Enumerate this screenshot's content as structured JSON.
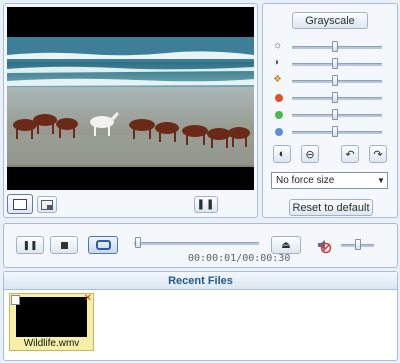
{
  "effects": {
    "grayscale_label": "Grayscale",
    "sliders": [
      {
        "icon": "brightness-icon",
        "level": 0.48
      },
      {
        "icon": "contrast-icon",
        "level": 0.48
      },
      {
        "icon": "color-icon",
        "level": 0.48
      },
      {
        "icon": "red-channel-icon",
        "color": "#e0502e",
        "level": 0.48
      },
      {
        "icon": "green-channel-icon",
        "color": "#4db94a",
        "level": 0.48
      },
      {
        "icon": "blue-channel-icon",
        "color": "#5a8de0",
        "level": 0.48
      }
    ],
    "force_size_value": "No force size",
    "reset_label": "Reset to default"
  },
  "transport": {
    "time_current": "00:00:01",
    "time_total": "00:00:30",
    "position": 0.03,
    "volume": 0.5
  },
  "recent": {
    "header": "Recent Files",
    "files": [
      {
        "name": "Wildlife.wmv"
      }
    ]
  },
  "colors": {
    "accent": "#1f5a8f",
    "border": "#a9bdd6",
    "selected": "#f6f0a6"
  }
}
